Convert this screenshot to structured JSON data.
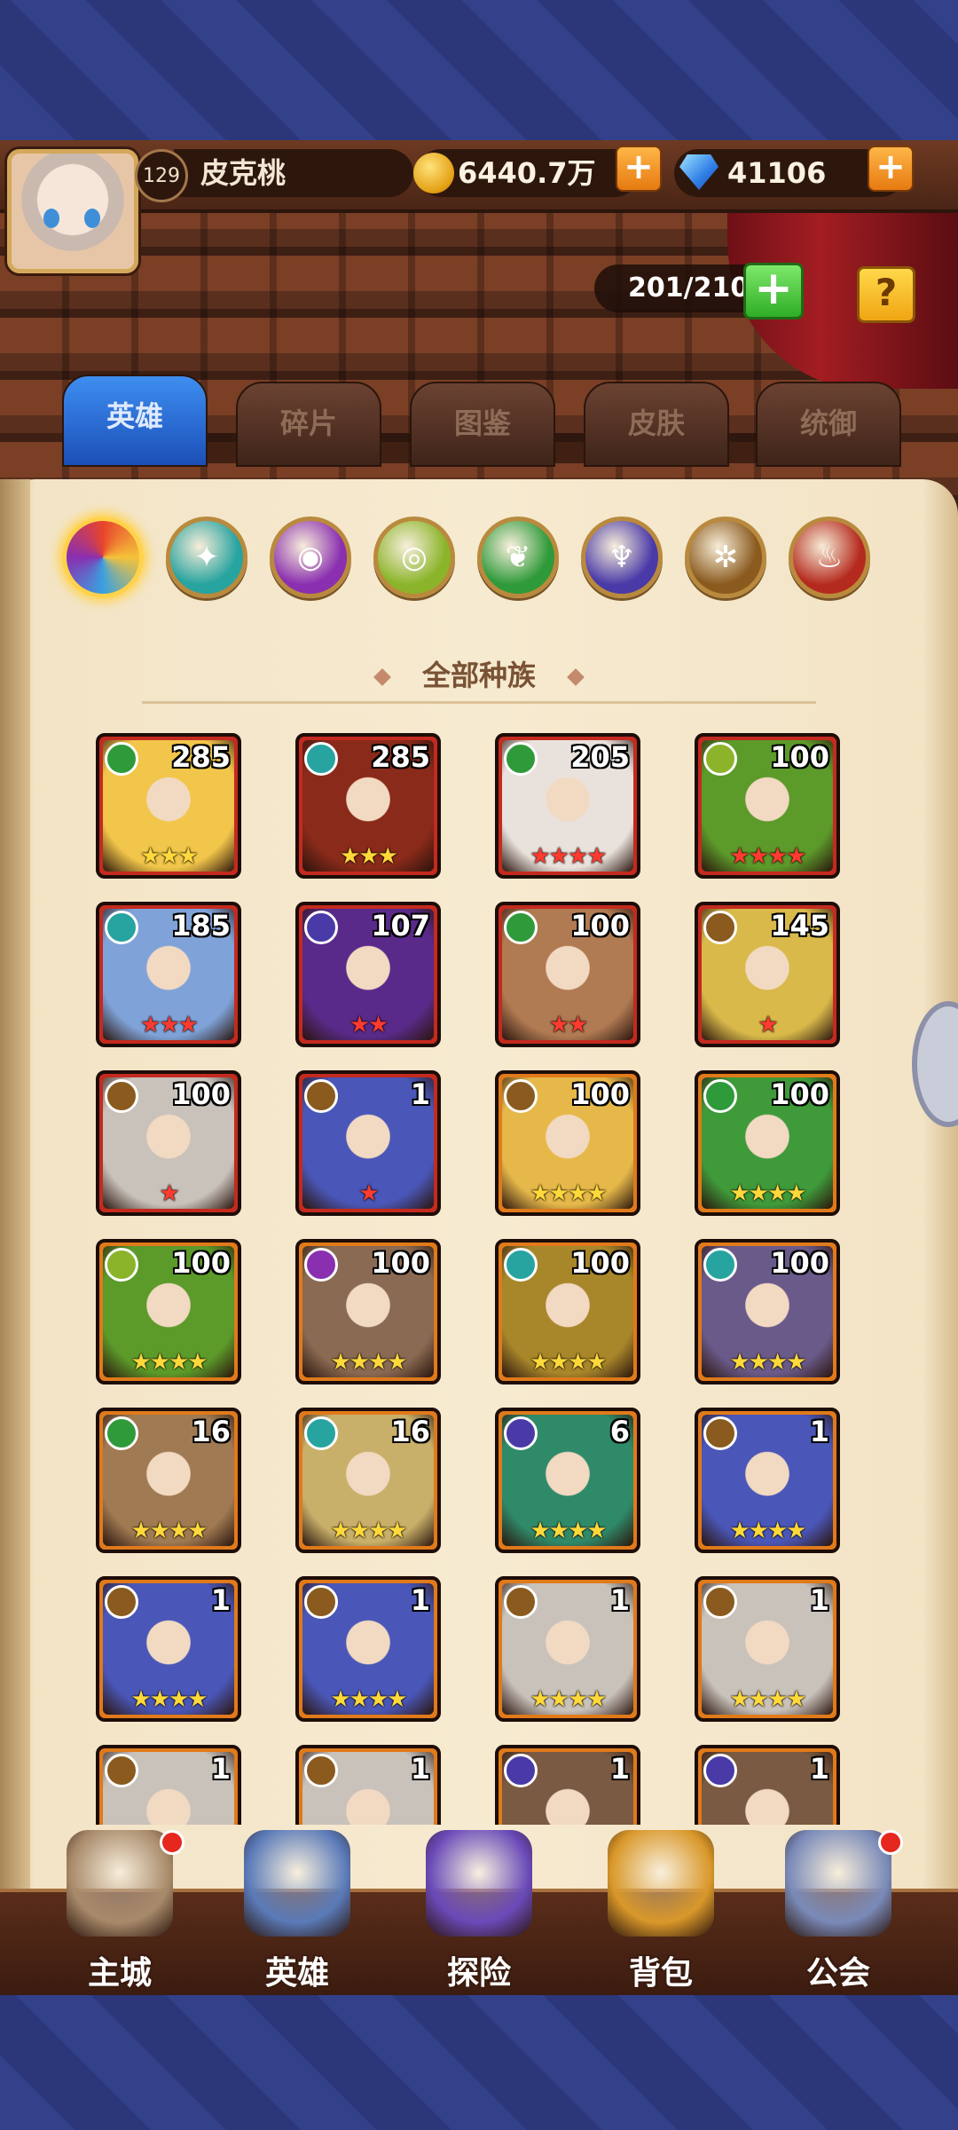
{
  "player": {
    "level": "129",
    "name": "皮克桃"
  },
  "resources": {
    "gold": "6440.7万",
    "gems": "41106"
  },
  "capacity": "201/210",
  "help_label": "?",
  "tabs": [
    {
      "label": "英雄",
      "active": true
    },
    {
      "label": "碎片",
      "active": false
    },
    {
      "label": "图鉴",
      "active": false
    },
    {
      "label": "皮肤",
      "active": false
    },
    {
      "label": "统御",
      "active": false
    }
  ],
  "factions": [
    {
      "icon": "all-factions-icon",
      "color": "#e8442c",
      "glyph": "◑"
    },
    {
      "icon": "wing-faction-icon",
      "color": "#27a3a0",
      "glyph": "✦"
    },
    {
      "icon": "shadow-faction-icon",
      "color": "#8a2fb0",
      "glyph": "◉"
    },
    {
      "icon": "nature-eye-faction-icon",
      "color": "#8bb42a",
      "glyph": "◎"
    },
    {
      "icon": "leaf-faction-icon",
      "color": "#2f9a3a",
      "glyph": "❦"
    },
    {
      "icon": "demon-faction-icon",
      "color": "#4a3aa8",
      "glyph": "♆"
    },
    {
      "icon": "light-faction-icon",
      "color": "#8a5a1e",
      "glyph": "✲"
    },
    {
      "icon": "fire-faction-icon",
      "color": "#b52a1e",
      "glyph": "♨"
    }
  ],
  "filter_title": "全部种族",
  "heroes": [
    {
      "level": "285",
      "stars": "★★★",
      "star_color": "gold",
      "element": "leaf",
      "elem_color": "#2f9a3a",
      "frame": "#c42a1f",
      "bg": "#f2c64a"
    },
    {
      "level": "285",
      "stars": "★★★",
      "star_color": "gold",
      "element": "wing",
      "elem_color": "#27a3a0",
      "frame": "#c42a1f",
      "bg": "#8a2a1a"
    },
    {
      "level": "205",
      "stars": "★★★★",
      "star_color": "red",
      "element": "leaf",
      "elem_color": "#2f9a3a",
      "frame": "#c42a1f",
      "bg": "#e9e2dc"
    },
    {
      "level": "100",
      "stars": "★★★★",
      "star_color": "red",
      "element": "nature-eye",
      "elem_color": "#8bb42a",
      "frame": "#c42a1f",
      "bg": "#5c9a2a"
    },
    {
      "level": "185",
      "stars": "★★★",
      "star_color": "red",
      "element": "wing",
      "elem_color": "#27a3a0",
      "frame": "#c42a1f",
      "bg": "#7fa3d8"
    },
    {
      "level": "107",
      "stars": "★★",
      "star_color": "red",
      "element": "demon",
      "elem_color": "#4a3aa8",
      "frame": "#c42a1f",
      "bg": "#5a2a8a"
    },
    {
      "level": "100",
      "stars": "★★",
      "star_color": "red",
      "element": "leaf",
      "elem_color": "#2f9a3a",
      "frame": "#c42a1f",
      "bg": "#b07a52"
    },
    {
      "level": "145",
      "stars": "★",
      "star_color": "red",
      "element": "light",
      "elem_color": "#8a5a1e",
      "frame": "#c42a1f",
      "bg": "#d9b94a"
    },
    {
      "level": "100",
      "stars": "★",
      "star_color": "red",
      "element": "light",
      "elem_color": "#8a5a1e",
      "frame": "#c42a1f",
      "bg": "#c9c2bb"
    },
    {
      "level": "1",
      "stars": "★",
      "star_color": "red",
      "element": "light",
      "elem_color": "#8a5a1e",
      "frame": "#c42a1f",
      "bg": "#4a57b8"
    },
    {
      "level": "100",
      "stars": "★★★★",
      "star_color": "gold",
      "element": "light",
      "elem_color": "#8a5a1e",
      "frame": "#e07a1a",
      "bg": "#e6b84a"
    },
    {
      "level": "100",
      "stars": "★★★★",
      "star_color": "gold",
      "element": "leaf",
      "elem_color": "#2f9a3a",
      "frame": "#e07a1a",
      "bg": "#3f9a3a"
    },
    {
      "level": "100",
      "stars": "★★★★",
      "star_color": "gold",
      "element": "nature-eye",
      "elem_color": "#8bb42a",
      "frame": "#e07a1a",
      "bg": "#5c9a2a"
    },
    {
      "level": "100",
      "stars": "★★★★",
      "star_color": "gold",
      "element": "shadow",
      "elem_color": "#8a2fb0",
      "frame": "#e07a1a",
      "bg": "#8a6a52"
    },
    {
      "level": "100",
      "stars": "★★★★",
      "star_color": "gold",
      "element": "wing",
      "elem_color": "#27a3a0",
      "frame": "#e07a1a",
      "bg": "#a8862a"
    },
    {
      "level": "100",
      "stars": "★★★★",
      "star_color": "gold",
      "element": "wing",
      "elem_color": "#27a3a0",
      "frame": "#e07a1a",
      "bg": "#6a5a8a"
    },
    {
      "level": "16",
      "stars": "★★★★",
      "star_color": "gold",
      "element": "leaf",
      "elem_color": "#2f9a3a",
      "frame": "#e07a1a",
      "bg": "#a07a52"
    },
    {
      "level": "16",
      "stars": "★★★★",
      "star_color": "gold",
      "element": "wing",
      "elem_color": "#27a3a0",
      "frame": "#e07a1a",
      "bg": "#c9b06a"
    },
    {
      "level": "6",
      "stars": "★★★★",
      "star_color": "gold",
      "element": "demon",
      "elem_color": "#4a3aa8",
      "frame": "#e07a1a",
      "bg": "#2f8a6a"
    },
    {
      "level": "1",
      "stars": "★★★★",
      "star_color": "gold",
      "element": "light",
      "elem_color": "#8a5a1e",
      "frame": "#e07a1a",
      "bg": "#4a57b8"
    },
    {
      "level": "1",
      "stars": "★★★★",
      "star_color": "gold",
      "element": "light",
      "elem_color": "#8a5a1e",
      "frame": "#e07a1a",
      "bg": "#4a57b8"
    },
    {
      "level": "1",
      "stars": "★★★★",
      "star_color": "gold",
      "element": "light",
      "elem_color": "#8a5a1e",
      "frame": "#e07a1a",
      "bg": "#4a57b8"
    },
    {
      "level": "1",
      "stars": "★★★★",
      "star_color": "gold",
      "element": "light",
      "elem_color": "#8a5a1e",
      "frame": "#e07a1a",
      "bg": "#c9c2bb"
    },
    {
      "level": "1",
      "stars": "★★★★",
      "star_color": "gold",
      "element": "light",
      "elem_color": "#8a5a1e",
      "frame": "#e07a1a",
      "bg": "#c9c2bb"
    },
    {
      "level": "1",
      "stars": "",
      "star_color": "gold",
      "element": "light",
      "elem_color": "#8a5a1e",
      "frame": "#e07a1a",
      "bg": "#c9c2bb"
    },
    {
      "level": "1",
      "stars": "",
      "star_color": "gold",
      "element": "light",
      "elem_color": "#8a5a1e",
      "frame": "#e07a1a",
      "bg": "#c9c2bb"
    },
    {
      "level": "1",
      "stars": "",
      "star_color": "gold",
      "element": "demon",
      "elem_color": "#4a3aa8",
      "frame": "#e07a1a",
      "bg": "#7a5a42"
    },
    {
      "level": "1",
      "stars": "",
      "star_color": "gold",
      "element": "demon",
      "elem_color": "#4a3aa8",
      "frame": "#e07a1a",
      "bg": "#7a5a42"
    }
  ],
  "nav": [
    {
      "label": "主城",
      "icon": "castle-icon",
      "color": "#a88a6a",
      "badge": true
    },
    {
      "label": "英雄",
      "icon": "hero-portrait-icon",
      "color": "#5a7ab8",
      "badge": false
    },
    {
      "label": "探险",
      "icon": "portal-icon",
      "color": "#6a4ab8",
      "badge": false
    },
    {
      "label": "背包",
      "icon": "backpack-icon",
      "color": "#d9982a",
      "badge": false
    },
    {
      "label": "公会",
      "icon": "guild-tower-icon",
      "color": "#7a8ab8",
      "badge": true
    }
  ]
}
